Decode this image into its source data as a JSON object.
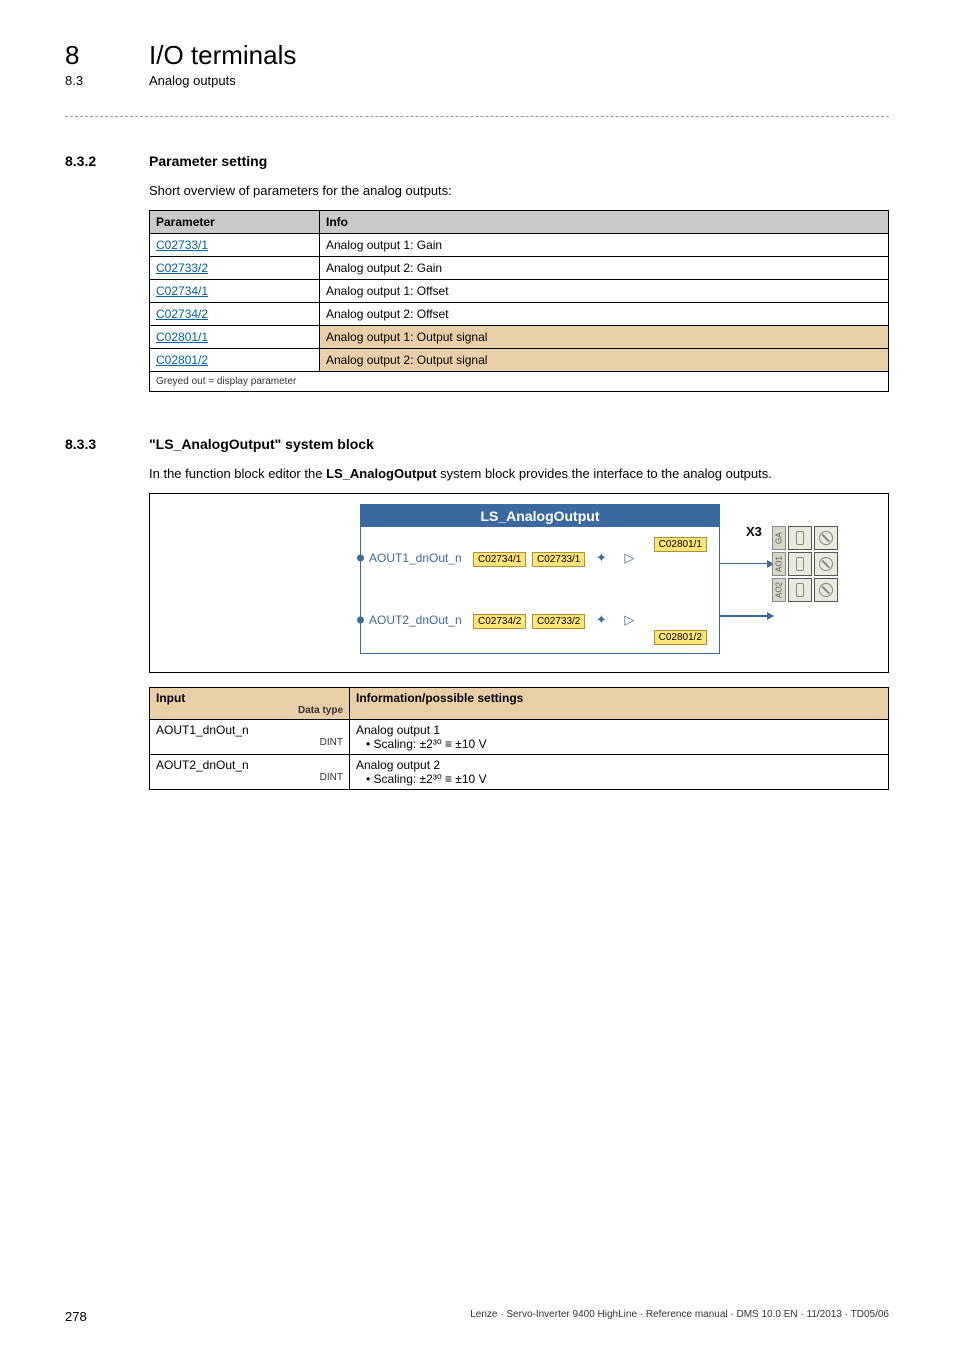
{
  "header": {
    "chapter_num": "8",
    "chapter_title": "I/O terminals",
    "section_num": "8.3",
    "section_title": "Analog outputs"
  },
  "sec_832": {
    "num": "8.3.2",
    "title": "Parameter setting",
    "intro": "Short overview of parameters for the analog outputs:",
    "table": {
      "head_param": "Parameter",
      "head_info": "Info",
      "rows": [
        {
          "code": "C02733/1",
          "info": "Analog output 1: Gain",
          "shaded": false
        },
        {
          "code": "C02733/2",
          "info": "Analog output 2: Gain",
          "shaded": false
        },
        {
          "code": "C02734/1",
          "info": "Analog output 1: Offset",
          "shaded": false
        },
        {
          "code": "C02734/2",
          "info": "Analog output 2: Offset",
          "shaded": false
        },
        {
          "code": "C02801/1",
          "info": "Analog output 1: Output signal",
          "shaded": true
        },
        {
          "code": "C02801/2",
          "info": "Analog output 2: Output signal",
          "shaded": true
        }
      ],
      "grey_note": "Greyed out = display parameter"
    }
  },
  "sec_833": {
    "num": "8.3.3",
    "title": "\"LS_AnalogOutput\" system block",
    "intro": "In the function block editor the LS_AnalogOutput system block provides the interface to the analog outputs.",
    "block": {
      "title": "LS_AnalogOutput",
      "rows": [
        {
          "port": "AOUT1_dnOut_n",
          "c_off": "C02734/1",
          "c_gain": "C02733/1",
          "c_out": "C02801/1"
        },
        {
          "port": "AOUT2_dnOut_n",
          "c_off": "C02734/2",
          "c_gain": "C02733/2",
          "c_out": "C02801/2"
        }
      ],
      "x3_label": "X3",
      "x3_terms": [
        "GA",
        "AO1",
        "AO2"
      ]
    },
    "io_table": {
      "head_input": "Input",
      "head_dtype": "Data type",
      "head_info": "Information/possible settings",
      "rows": [
        {
          "name": "AOUT1_dnOut_n",
          "dtype": "DINT",
          "desc": "Analog output 1",
          "scale": "• Scaling: ±2³⁰ ≡ ±10 V"
        },
        {
          "name": "AOUT2_dnOut_n",
          "dtype": "DINT",
          "desc": "Analog output 2",
          "scale": "• Scaling: ±2³⁰ ≡ ±10 V"
        }
      ]
    }
  },
  "footer": {
    "page": "278",
    "meta": "Lenze · Servo-Inverter 9400 HighLine · Reference manual · DMS 10.0 EN · 11/2013 · TD05/06"
  }
}
